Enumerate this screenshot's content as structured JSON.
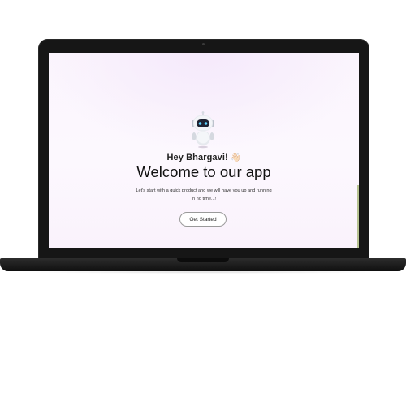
{
  "screen": {
    "greeting": "Hey Bhargavi!",
    "greeting_emoji": "👋🏻",
    "title": "Welcome to our app",
    "subtitle": "Let's start with a quick product and we will have you up and running in no time...!",
    "cta_label": "Get Started"
  },
  "colors": {
    "bezel": "#161616",
    "screen_background": "#fbf5fd",
    "button_border": "#9a9a9a",
    "text_primary": "#111111"
  },
  "icons": {
    "mascot": "robot-mascot-icon",
    "greeting_emoji": "waving-hand-icon"
  }
}
